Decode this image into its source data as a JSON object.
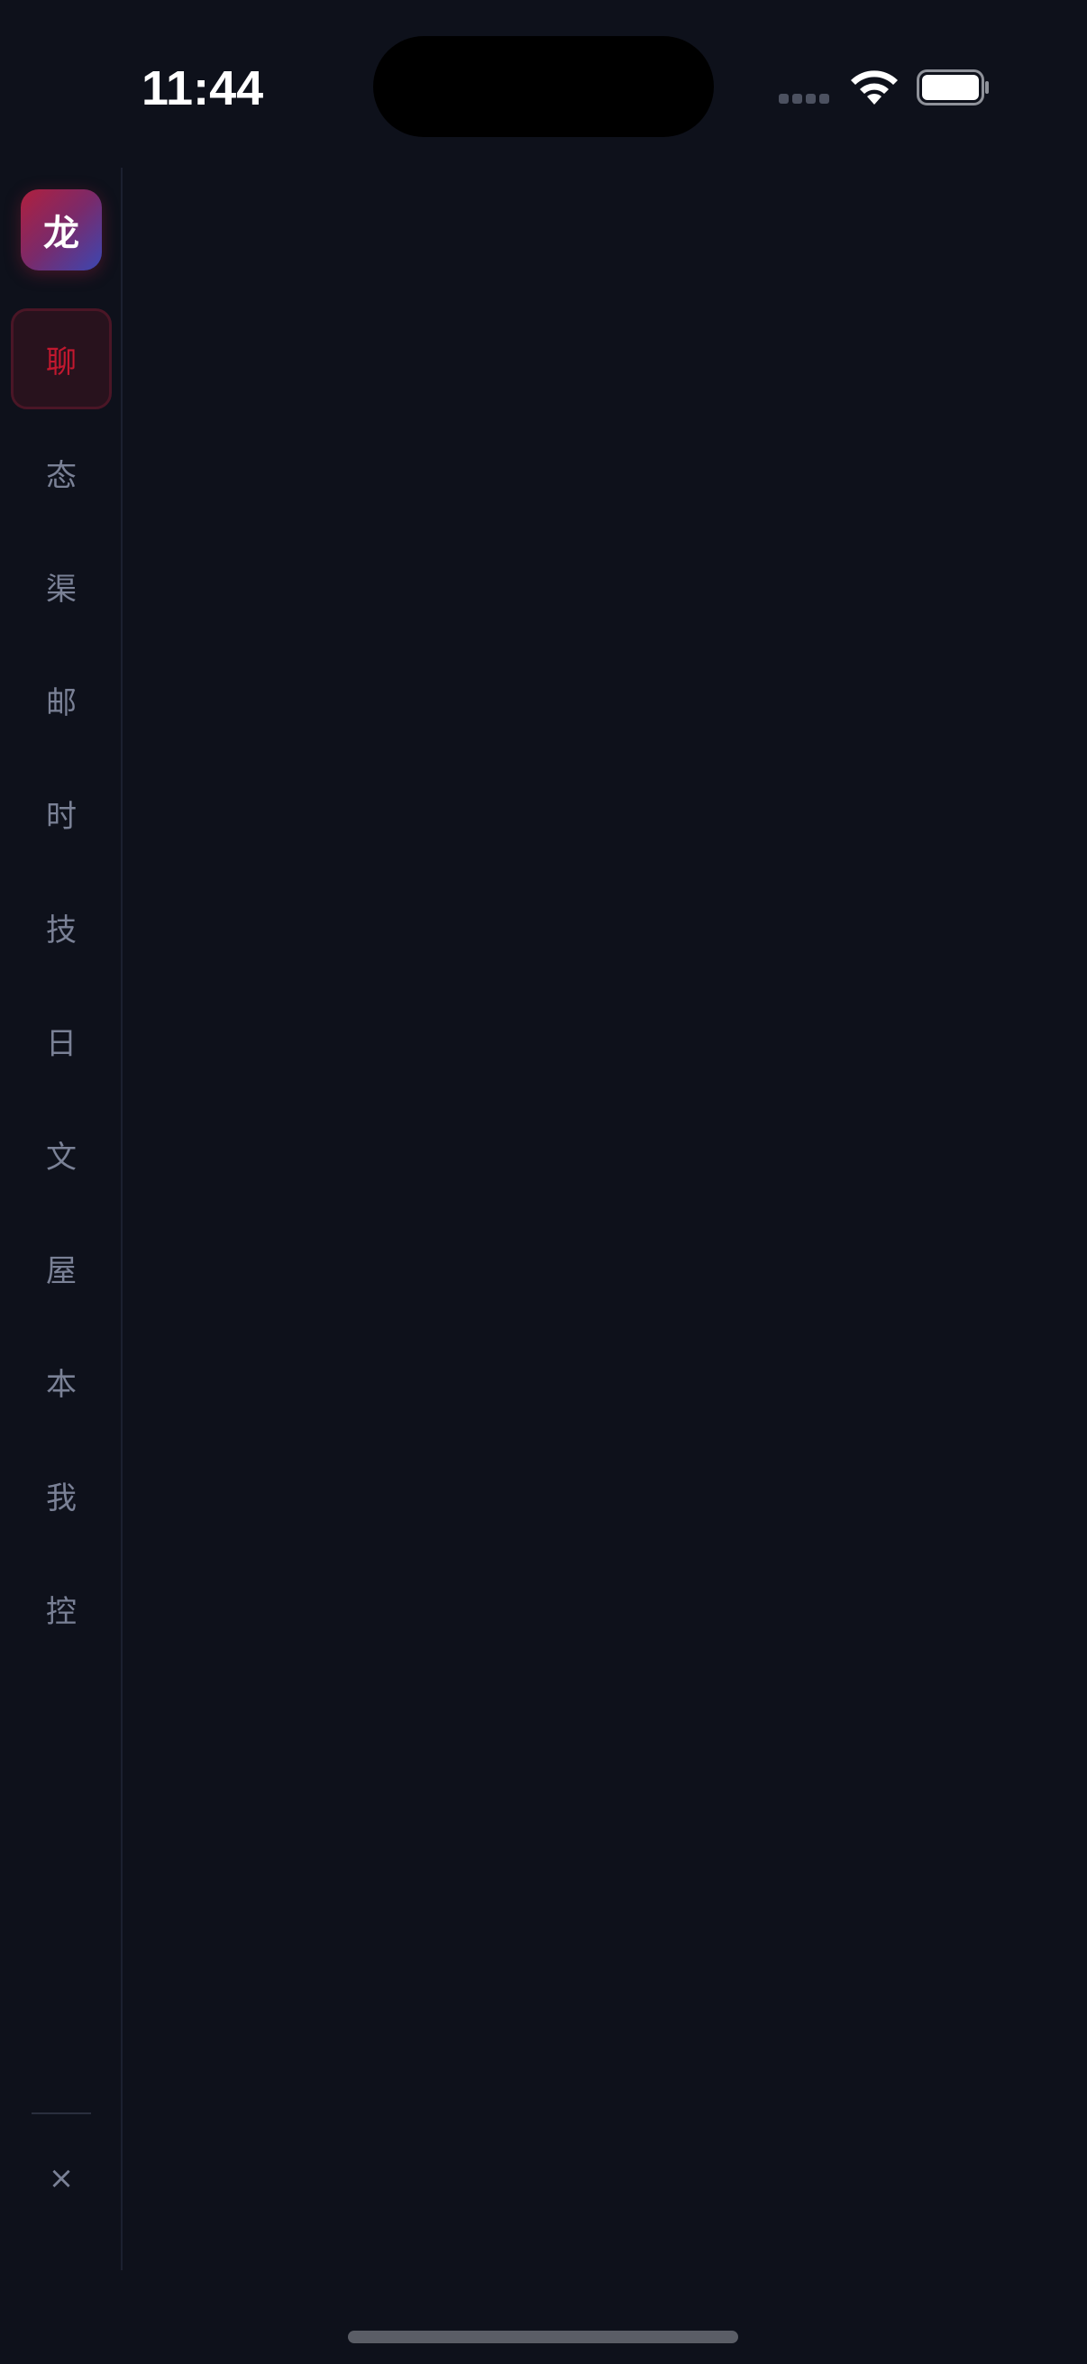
{
  "status_bar": {
    "time": "11:44"
  },
  "sidebar": {
    "logo_text": "龙",
    "items": [
      {
        "label": "聊",
        "active": true
      },
      {
        "label": "态",
        "active": false
      },
      {
        "label": "渠",
        "active": false
      },
      {
        "label": "邮",
        "active": false
      },
      {
        "label": "时",
        "active": false
      },
      {
        "label": "技",
        "active": false
      },
      {
        "label": "日",
        "active": false
      },
      {
        "label": "文",
        "active": false
      },
      {
        "label": "屋",
        "active": false
      },
      {
        "label": "本",
        "active": false
      },
      {
        "label": "我",
        "active": false
      },
      {
        "label": "控",
        "active": false
      }
    ],
    "close_label": "×"
  },
  "colors": {
    "background": "#0e111b",
    "accent": "#c2182f",
    "inactive_text": "#7a8196"
  }
}
